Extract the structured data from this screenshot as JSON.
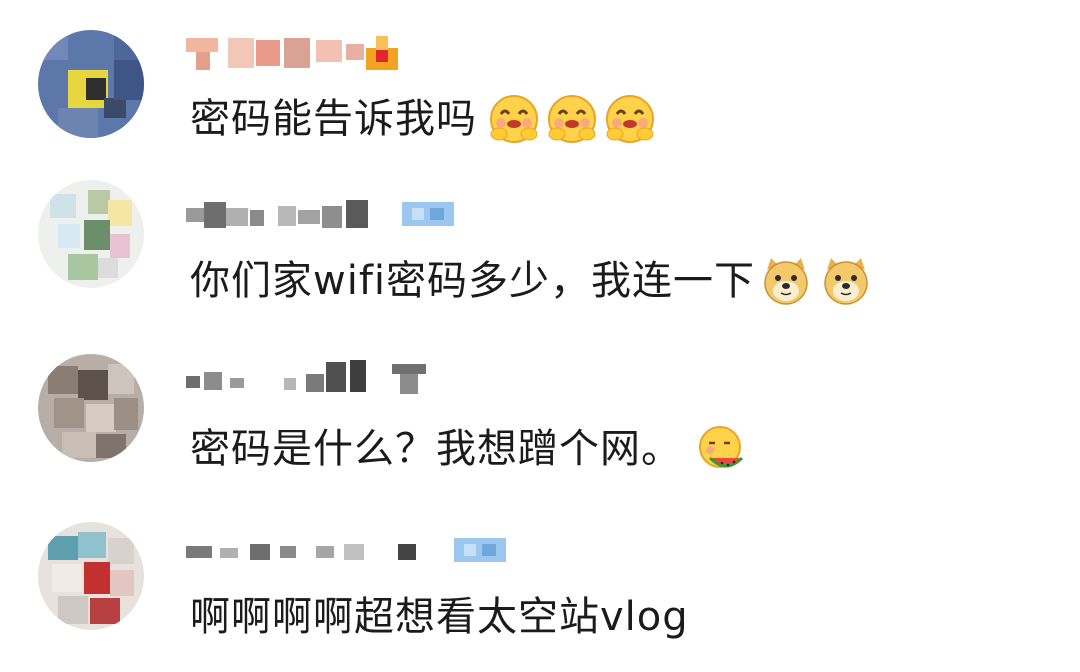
{
  "comments": [
    {
      "text": "密码能告诉我吗",
      "emojis": [
        "hug-emoji",
        "hug-emoji",
        "hug-emoji"
      ],
      "badge_color": "#f2a322"
    },
    {
      "text": "你们家wifi密码多少，我连一下",
      "emojis": [
        "doge-emoji",
        "doge-emoji"
      ],
      "badge_color": "#9cc8f0"
    },
    {
      "text": "密码是什么？我想蹭个网。",
      "emojis": [
        "eating-watermelon-emoji"
      ],
      "badge_color": "#707070"
    },
    {
      "text": "啊啊啊啊超想看太空站vlog",
      "emojis": [],
      "badge_color": "#9cc8f0"
    }
  ]
}
